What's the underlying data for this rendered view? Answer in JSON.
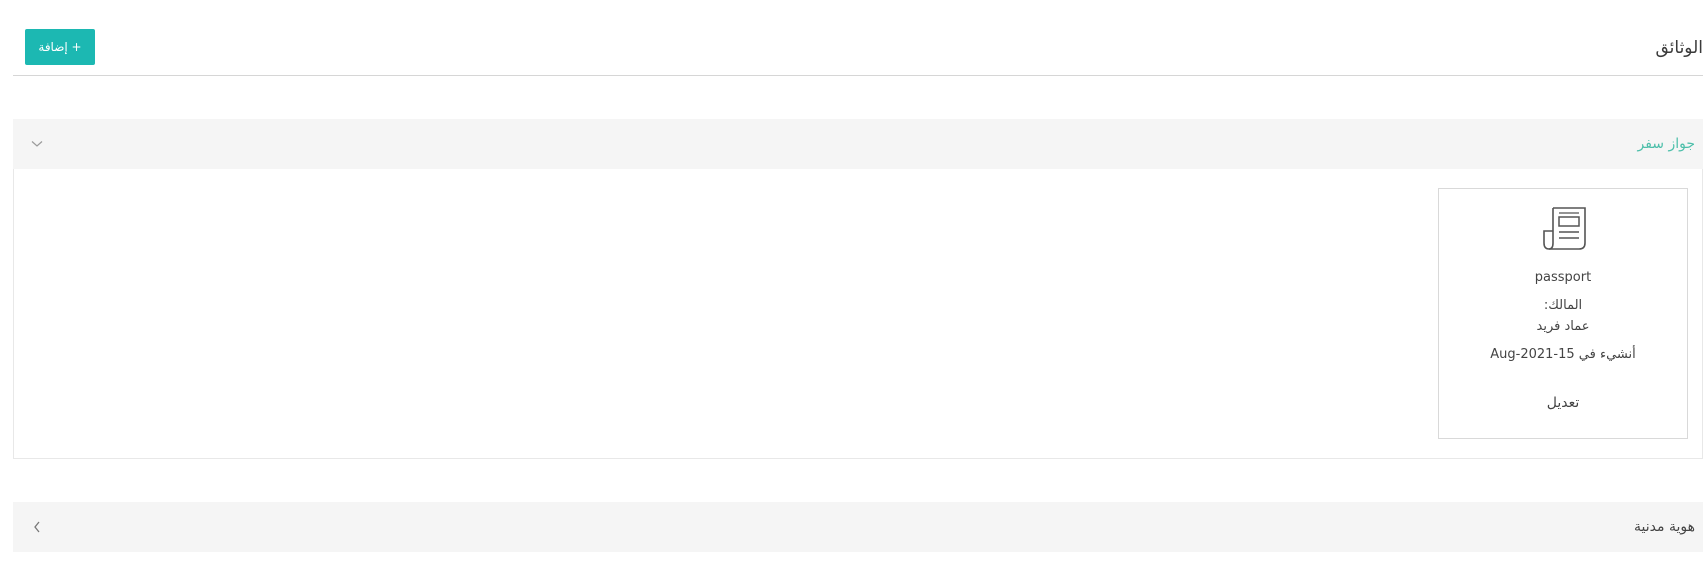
{
  "header": {
    "title": "الوثائق",
    "add_label": "+ إضافة"
  },
  "sections": [
    {
      "title": "جواز سفر",
      "expanded": true,
      "cards": [
        {
          "icon": "document-icon",
          "name": "passport",
          "owner_label": "المالك:",
          "owner_name": "عماد فريد",
          "created": "أنشيء في 15-2021-Aug",
          "edit_label": "تعديل"
        }
      ]
    },
    {
      "title": "هوية مدنية",
      "expanded": false
    }
  ],
  "colors": {
    "accent": "#1cb8b2",
    "active_section_title": "#4dbfaa",
    "section_header_bg": "#f5f5f5"
  }
}
